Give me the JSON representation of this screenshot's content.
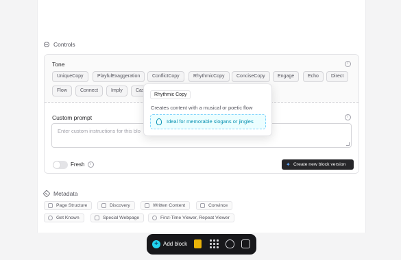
{
  "controls": {
    "header": "Controls",
    "tone": {
      "label": "Tone",
      "chips": [
        "UniqueCopy",
        "PlayfulExaggeration",
        "ConflictCopy",
        "RhythmicCopy",
        "ConciseCopy",
        "Engage",
        "Echo",
        "Direct",
        "Flow",
        "Connect",
        "Imply",
        "Cas"
      ]
    },
    "custom_prompt": {
      "label": "Custom prompt",
      "placeholder": "Enter custom instructions for this blo"
    },
    "fresh": {
      "label": "Fresh",
      "on": false
    },
    "create_button": "Create new block version"
  },
  "tooltip": {
    "title": "Rhythmic Copy",
    "description": "Creates content with a musical or poetic flow",
    "tip": "Ideal for memorable slogans or jingles"
  },
  "metadata": {
    "header": "Metadata",
    "tags": [
      {
        "label": "Page Structure",
        "icon": "layout-icon"
      },
      {
        "label": "Discovery",
        "icon": "filter-icon"
      },
      {
        "label": "Written Content",
        "icon": "document-icon"
      },
      {
        "label": "Convince",
        "icon": "pencil-icon"
      },
      {
        "label": "Get Known",
        "icon": "target-icon"
      },
      {
        "label": "Special Webpage",
        "icon": "image-icon"
      },
      {
        "label": "First-Time Viewer, Repeat Viewer",
        "icon": "crosshair-icon"
      }
    ]
  },
  "dock": {
    "add_label": "Add block",
    "tools": [
      "note-icon",
      "grid-icon",
      "brain-icon",
      "chip-icon"
    ],
    "accent": "#22d3ee"
  }
}
